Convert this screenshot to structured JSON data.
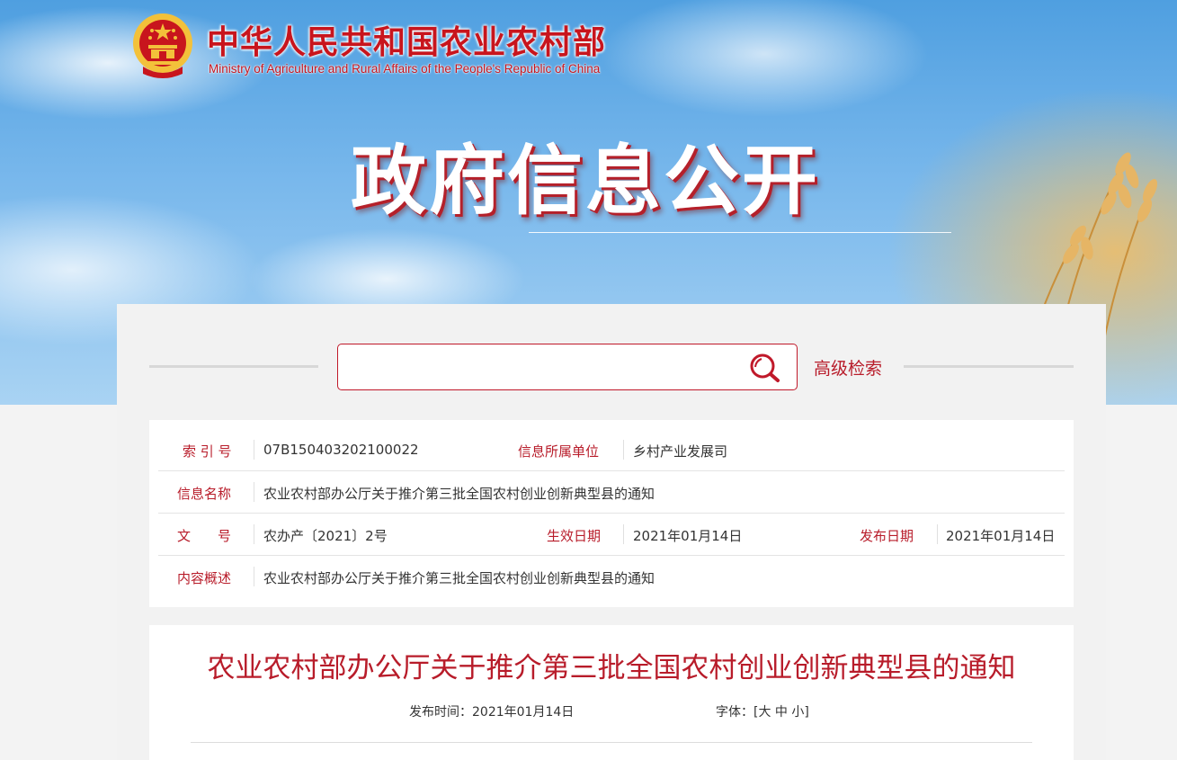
{
  "header": {
    "ministry_cn": "中华人民共和国农业农村部",
    "ministry_en": "Ministry of Agriculture and Rural Affairs of the People's Republic of China",
    "hero_title": "政府信息公开"
  },
  "search": {
    "placeholder": "",
    "advanced_label": "高级检索"
  },
  "info": {
    "index_label": "索 引 号",
    "index_value": "07B150403202100022",
    "unit_label": "信息所属单位",
    "unit_value": "乡村产业发展司",
    "name_label": "信息名称",
    "name_value": "农业农村部办公厅关于推介第三批全国农村创业创新典型县的通知",
    "docno_label": "文　　号",
    "docno_value": "农办产〔2021〕2号",
    "effective_label": "生效日期",
    "effective_value": "2021年01月14日",
    "publish_label": "发布日期",
    "publish_value": "2021年01月14日",
    "summary_label": "内容概述",
    "summary_value": "农业农村部办公厅关于推介第三批全国农村创业创新典型县的通知"
  },
  "article": {
    "title": "农业农村部办公厅关于推介第三批全国农村创业创新典型县的通知",
    "publish_time": "发布时间：2021年01月14日",
    "font_label": "字体：[",
    "font_large": "大",
    "font_medium": "中",
    "font_small": "小",
    "font_close": "]"
  },
  "colors": {
    "accent": "#b81c2a",
    "emblem_red": "#c8151d",
    "emblem_gold": "#f3c13a"
  }
}
